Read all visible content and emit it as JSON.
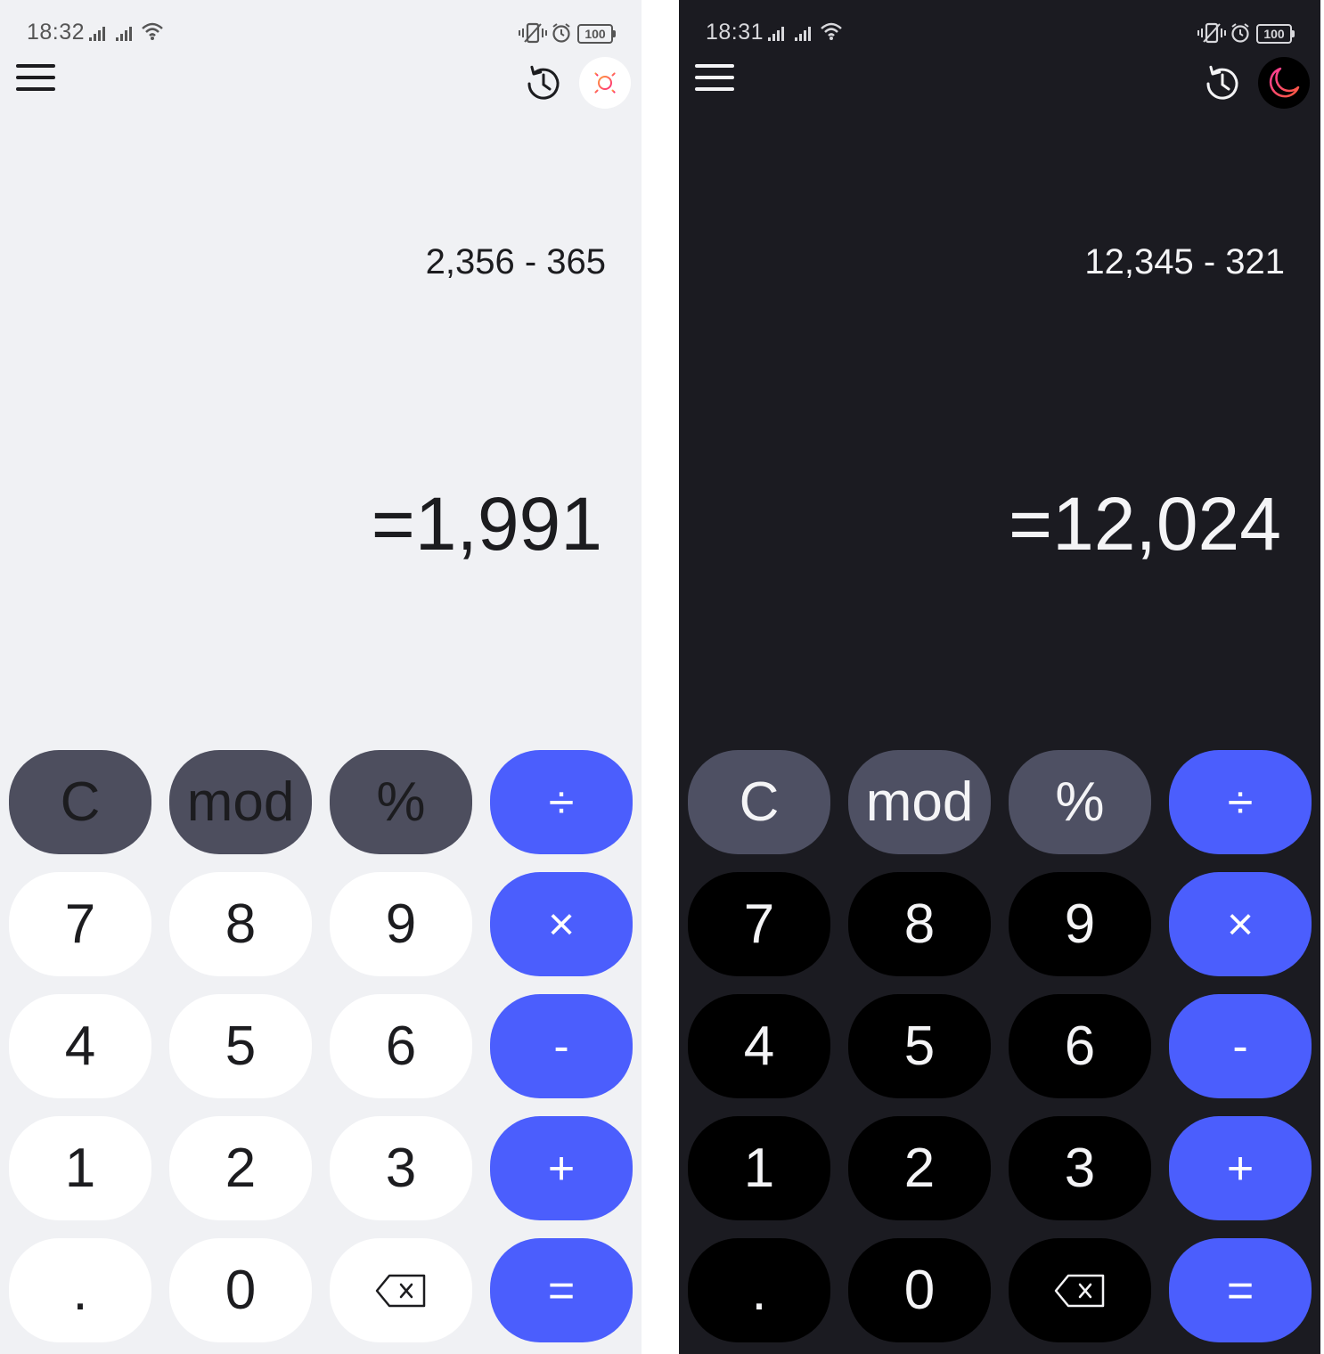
{
  "screens": [
    {
      "theme": "light",
      "status": {
        "time": "18:32",
        "battery": "100"
      },
      "theme_icon": "sun-icon",
      "expression": "2,356 - 365",
      "result": "=1,991"
    },
    {
      "theme": "dark",
      "status": {
        "time": "18:31",
        "battery": "100"
      },
      "theme_icon": "moon-icon",
      "expression": "12,345 - 321",
      "result": "=12,024"
    }
  ],
  "keys": {
    "clear": "C",
    "mod": "mod",
    "percent": "%",
    "divide": "÷",
    "seven": "7",
    "eight": "8",
    "nine": "9",
    "multiply": "×",
    "four": "4",
    "five": "5",
    "six": "6",
    "minus": "-",
    "one": "1",
    "two": "2",
    "three": "3",
    "plus": "+",
    "dot": ".",
    "zero": "0",
    "equals": "="
  },
  "icons": {
    "menu": "hamburger-menu-icon",
    "history": "history-icon",
    "backspace": "backspace-icon"
  },
  "colors": {
    "accent": "#4b5efd",
    "light_bg": "#f0f1f4",
    "dark_bg": "#1b1b21",
    "func_key_light": "#4d4e5e",
    "func_key_dark": "#4e5063",
    "sun": "#ff3d6a",
    "moon": "#ff3d6a"
  }
}
